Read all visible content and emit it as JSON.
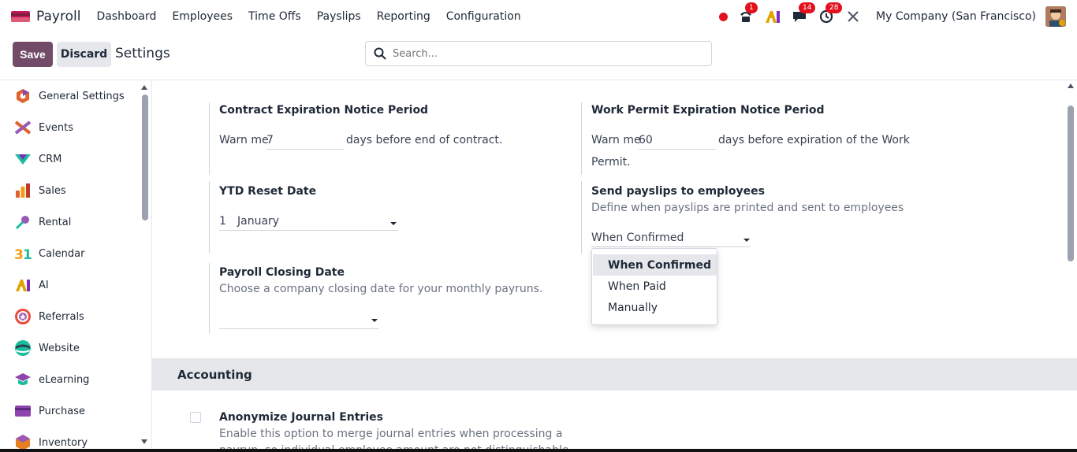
{
  "navbar": {
    "app_name": "Payroll",
    "menu": [
      "Dashboard",
      "Employees",
      "Time Offs",
      "Payslips",
      "Reporting",
      "Configuration"
    ],
    "badges": {
      "phone": "1",
      "chat": "14",
      "activity": "28"
    },
    "company": "My Company (San Francisco)"
  },
  "control": {
    "save_label": "Save",
    "discard_label": "Discard",
    "breadcrumb": "Settings",
    "search_placeholder": "Search..."
  },
  "sidebar": {
    "items": [
      {
        "label": "General Settings",
        "icon": "general-settings-icon"
      },
      {
        "label": "Events",
        "icon": "events-icon"
      },
      {
        "label": "CRM",
        "icon": "crm-icon"
      },
      {
        "label": "Sales",
        "icon": "sales-icon"
      },
      {
        "label": "Rental",
        "icon": "rental-icon"
      },
      {
        "label": "Calendar",
        "icon": "calendar-icon"
      },
      {
        "label": "AI",
        "icon": "ai-icon"
      },
      {
        "label": "Referrals",
        "icon": "referrals-icon"
      },
      {
        "label": "Website",
        "icon": "website-icon"
      },
      {
        "label": "eLearning",
        "icon": "elearning-icon"
      },
      {
        "label": "Purchase",
        "icon": "purchase-icon"
      },
      {
        "label": "Inventory",
        "icon": "inventory-icon"
      }
    ]
  },
  "settings": {
    "contract": {
      "title": "Contract Expiration Notice Period",
      "prefix": "Warn me",
      "value": "7",
      "suffix": "days before end of contract."
    },
    "work_permit": {
      "title": "Work Permit Expiration Notice Period",
      "prefix": "Warn me",
      "value": "60",
      "suffix": "days before expiration of the Work",
      "suffix2": "Permit."
    },
    "ytd": {
      "title": "YTD Reset Date",
      "day": "1",
      "month": "January"
    },
    "send_payslips": {
      "title": "Send payslips to employees",
      "description": "Define when payslips are printed and sent to employees",
      "value": "When Confirmed",
      "options": [
        "When Confirmed",
        "When Paid",
        "Manually"
      ]
    },
    "closing": {
      "title": "Payroll Closing Date",
      "description": "Choose a company closing date for your monthly payruns.",
      "value": ""
    },
    "accounting_section": "Accounting",
    "anonymize": {
      "title": "Anonymize Journal Entries",
      "description": "Enable this option to merge journal entries when processing a",
      "description2": "payrun, so individual employee amount are not distinguishable."
    }
  },
  "colors": {
    "brand": "#714b67",
    "badge": "#e3101e"
  }
}
